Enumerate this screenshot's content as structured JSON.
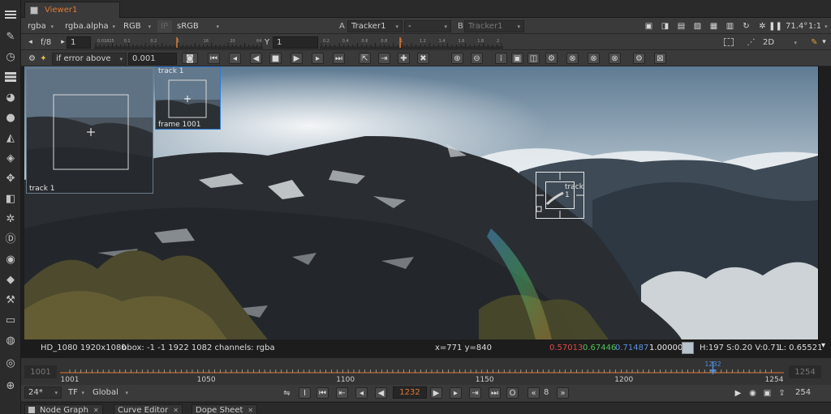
{
  "tabs": {
    "viewer": "Viewer1"
  },
  "row1": {
    "channels": "rgba",
    "alpha_channel": "rgba.alpha",
    "display": "RGB",
    "ip_label": "IP",
    "lut": "sRGB",
    "input_a_label": "A",
    "input_a": "Tracker1",
    "composite": "-",
    "input_b_label": "B",
    "input_b": "Tracker1",
    "zoom": "71.4°",
    "proxy": "1:1"
  },
  "row2": {
    "fstop": "f/8",
    "gain_value": "1",
    "gain_ticks": [
      "0.01825",
      "0.1",
      "0.2",
      "1",
      "16",
      "20",
      "64"
    ],
    "gamma_label": "Y",
    "gamma_value": "1",
    "gamma_ticks": [
      "0.2",
      "0.4",
      "0.6",
      "0.8",
      "1",
      "1.2",
      "1.4",
      "1.6",
      "1.8",
      "2"
    ],
    "view_mode": "2D"
  },
  "row3": {
    "error_mode": "if error above",
    "error_value": "0.001"
  },
  "viewer": {
    "zoom_window_label": "track 1",
    "keyframe_label": "track 1",
    "keyframe_frame": "frame 1001",
    "track_label": "track 1"
  },
  "infobar": {
    "format": "HD_1080 1920x1080",
    "bbox": "bbox: -1 -1 1922 1082 channels: rgba",
    "coords": "x=771 y=840",
    "r": "0.57013",
    "g": "0.67446",
    "b": "0.71487",
    "a": "1.00000",
    "hsv": "H:197 S:0.20 V:0.71",
    "luma": "L: 0.65521",
    "colors": {
      "r": "#e04848",
      "g": "#4ec15a",
      "b": "#5b8fe0",
      "swatch": "#b6c3cc"
    }
  },
  "timeline": {
    "in_field": "1001",
    "out_field": "1254",
    "labels": [
      "1001",
      "1050",
      "1100",
      "1150",
      "1200",
      "1254"
    ],
    "label_frames": [
      1001,
      1050,
      1100,
      1150,
      1200,
      1254
    ],
    "start": 1001,
    "end": 1254,
    "current": "1232",
    "current_frame": 1232
  },
  "playbar": {
    "fps": "24*",
    "timecode_mode": "TF",
    "range_mode": "Global",
    "current_frame": "1232",
    "step": "8",
    "end_frame": "254"
  },
  "bottom_tabs": [
    "Node Graph",
    "Curve Editor",
    "Dope Sheet"
  ]
}
